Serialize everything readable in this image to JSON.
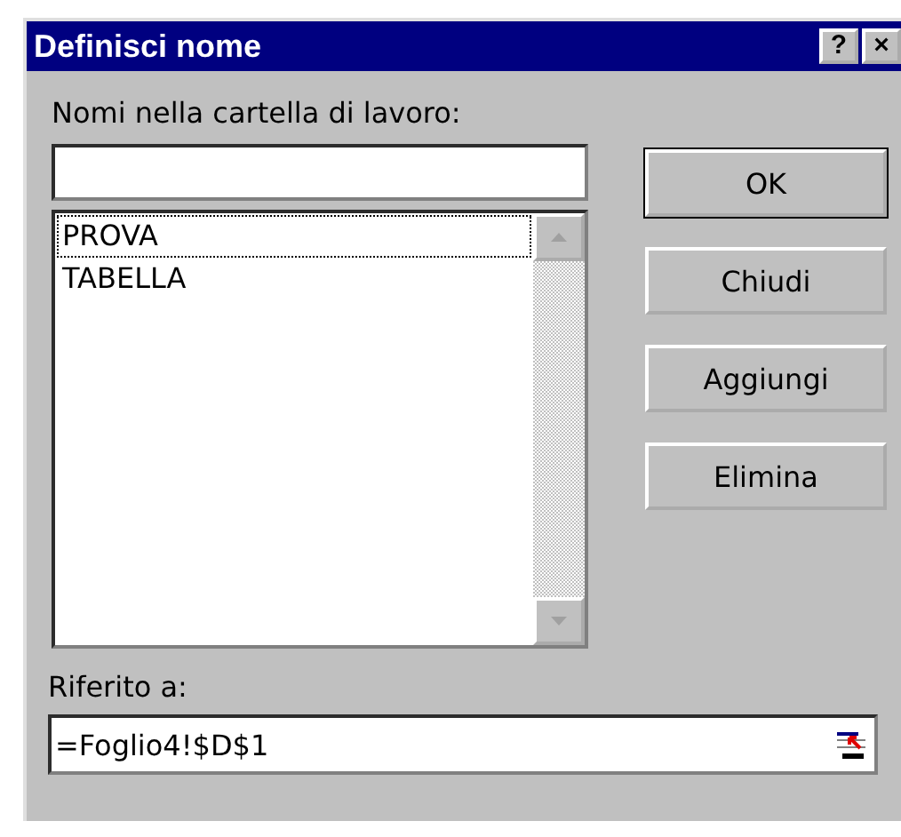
{
  "window": {
    "title": "Definisci nome",
    "title_buttons": [
      "?",
      "×"
    ]
  },
  "names_label": "Nomi nella cartella di lavoro:",
  "names_list": [
    {
      "label": "PROVA",
      "selected": true
    },
    {
      "label": "TABELLA",
      "selected": false
    }
  ],
  "buttons": [
    {
      "label": "OK",
      "default": true
    },
    {
      "label": "Chiudi",
      "default": false
    },
    {
      "label": "Aggiungi",
      "default": false
    },
    {
      "label": "Elimina",
      "default": false
    }
  ],
  "reference_label": "Riferito a:",
  "reference_field": {
    "value": "=Foglio4!$D$1"
  }
}
